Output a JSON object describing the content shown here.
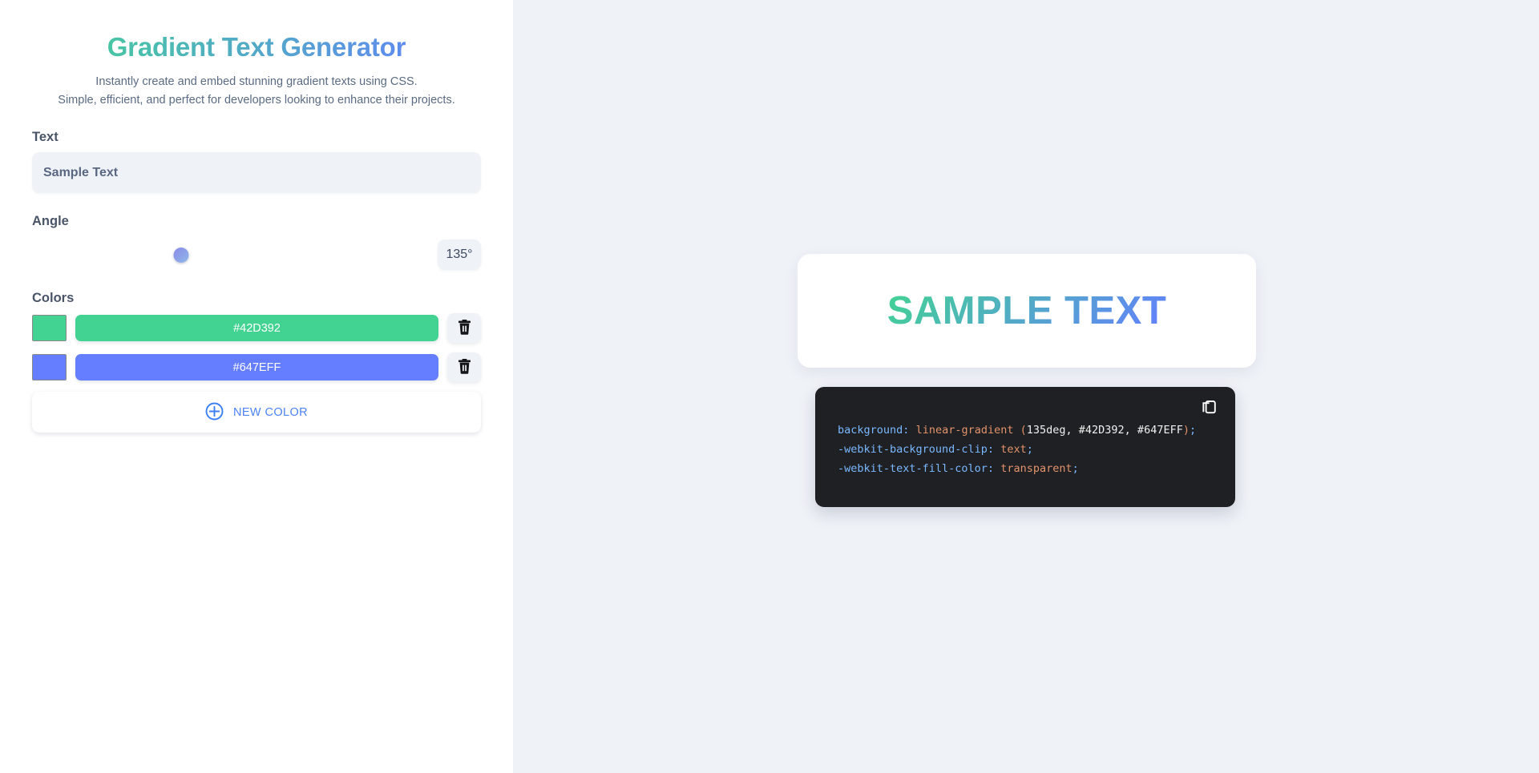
{
  "app": {
    "title": "Gradient Text Generator",
    "subtitle_line1": "Instantly create and embed stunning gradient texts using CSS.",
    "subtitle_line2": "Simple, efficient, and perfect for developers looking to enhance their projects.",
    "title_gradient_from": "#42D392",
    "title_gradient_to": "#647EFF"
  },
  "form": {
    "text_label": "Text",
    "text_value": "Sample Text",
    "text_placeholder": "Sample Text",
    "angle_label": "Angle",
    "angle_value": "135°",
    "angle_number": 135,
    "angle_min": 0,
    "angle_max": 360,
    "angle_percent": 37.5,
    "colors_label": "Colors",
    "colors": [
      {
        "hex": "#42D392",
        "delete_icon": "trash-icon"
      },
      {
        "hex": "#647EFF",
        "delete_icon": "trash-icon"
      }
    ],
    "new_color_label": "NEW COLOR",
    "new_color_icon": "plus-circle-icon"
  },
  "preview": {
    "text": "SAMPLE TEXT",
    "gradient_angle_deg": 135,
    "gradient_from": "#42D392",
    "gradient_to": "#647EFF"
  },
  "code": {
    "copy_icon": "copy-icon",
    "line1": {
      "prop": "background",
      "colon": ":",
      "fn": "linear-gradient",
      "open": "(",
      "args": "135deg, #42D392, #647EFF",
      "close": ")",
      "semi": ";"
    },
    "line2": {
      "prop": "-webkit-background-clip",
      "colon": ":",
      "value": "text",
      "semi": ";"
    },
    "line3": {
      "prop": "-webkit-text-fill-color",
      "colon": ":",
      "value": "transparent",
      "semi": ";"
    }
  },
  "theme": {
    "panel_bg": "#ffffff",
    "canvas_bg": "#eff2f7",
    "code_bg": "#1f2023",
    "accent_blue": "#4d82f7",
    "label_color": "#4a5568"
  }
}
